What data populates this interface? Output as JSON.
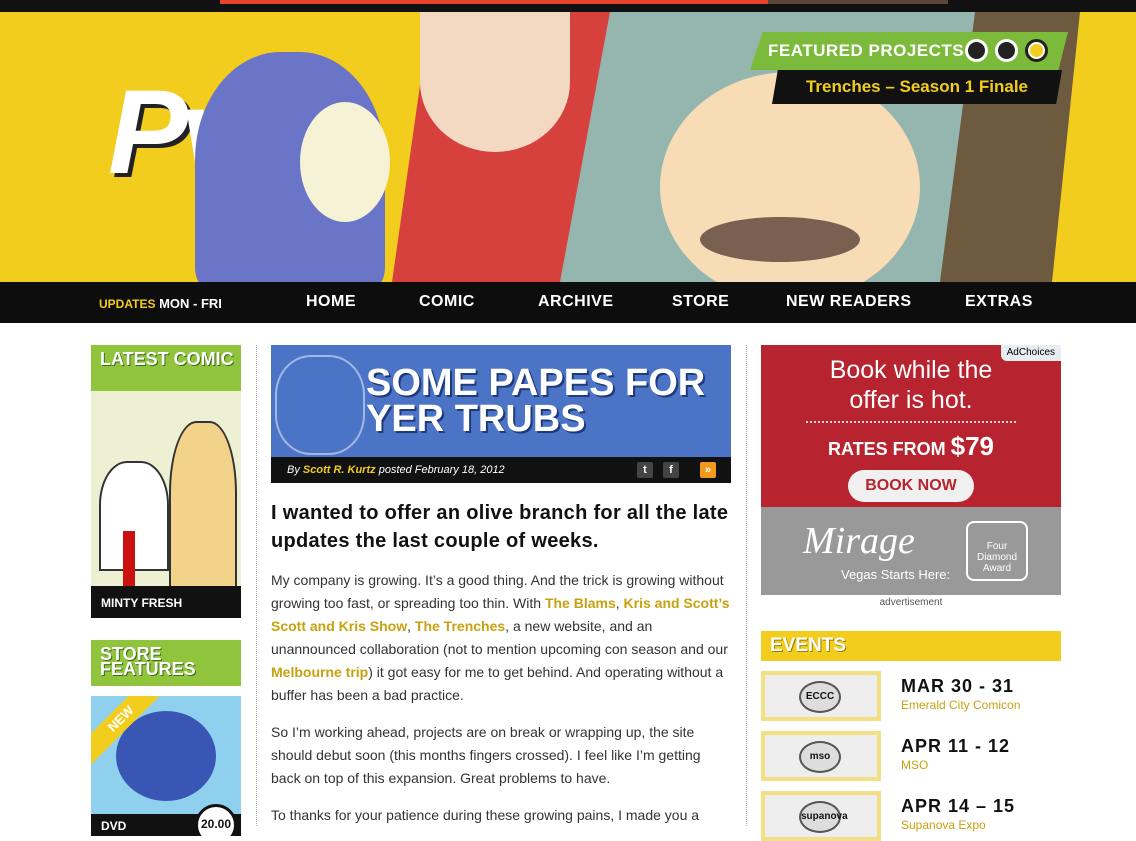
{
  "featured": {
    "label": "FEATURED PROJECTS",
    "title": "Trenches – Season 1 Finale"
  },
  "nav": {
    "updates_label": "UPDATES",
    "updates_days": "MON - FRI",
    "items": [
      "HOME",
      "COMIC",
      "ARCHIVE",
      "STORE",
      "NEW READERS",
      "EXTRAS"
    ]
  },
  "left": {
    "latest_label": "LATEST COMIC",
    "latest_caption": "MINTY FRESH",
    "store_label": "STORE FEATURES",
    "store_ribbon": "NEW",
    "store_item": "DVD",
    "store_price": "20.00"
  },
  "post": {
    "banner_title": "SOME PAPES FOR YER TRUBS",
    "by_prefix": "By",
    "author": "Scott R. Kurtz",
    "posted": "posted February 18, 2012",
    "social": {
      "twitter": "t",
      "facebook": "f",
      "rss": "»"
    },
    "headline": "I wanted to offer an olive branch for all the late updates the last couple of weeks.",
    "p1": {
      "t1": "My company is growing. It’s a good thing. And the trick is growing without growing too fast, or spreading too thin. With ",
      "l1": "The Blams",
      "t2": ", ",
      "l2": "Kris and Scott’s Scott and Kris Show",
      "t3": ", ",
      "l3": "The Trenches",
      "t4": ", a new website, and an unannounced collaboration (not to mention upcoming con season and our ",
      "l4": "Melbourne trip",
      "t5": ") it got easy for me to get behind. And operating without a buffer has been a bad practice."
    },
    "p2": "So I’m working ahead, projects are on break or wrapping up, the site should debut soon (this months fingers crossed). I feel like I’m getting back on top of this expansion. Great problems to have.",
    "p3": "To thanks for your patience during these growing pains, I made you a"
  },
  "ad": {
    "adchoices": "AdChoices",
    "line1": "Book while the",
    "line2": "offer is hot.",
    "rates": "RATES FROM",
    "price": "$79",
    "button": "BOOK NOW",
    "brand": "Mirage",
    "tagline": "Vegas Starts Here:",
    "award": "Four Diamond Award",
    "label": "advertisement"
  },
  "events": {
    "label": "EVENTS",
    "items": [
      {
        "date": "MAR 30 - 31",
        "name": "Emerald City Comicon",
        "logo": "ECCC"
      },
      {
        "date": "APR 11 - 12",
        "name": "MSO",
        "logo": "mso"
      },
      {
        "date": "APR 14 – 15",
        "name": "Supanova Expo",
        "logo": "supanova"
      }
    ]
  },
  "colors": {
    "yellow": "#f2cd1e",
    "green": "#8fc43c",
    "blue": "#4b74c6",
    "red": "#b7232e",
    "link": "#c8a10f"
  }
}
